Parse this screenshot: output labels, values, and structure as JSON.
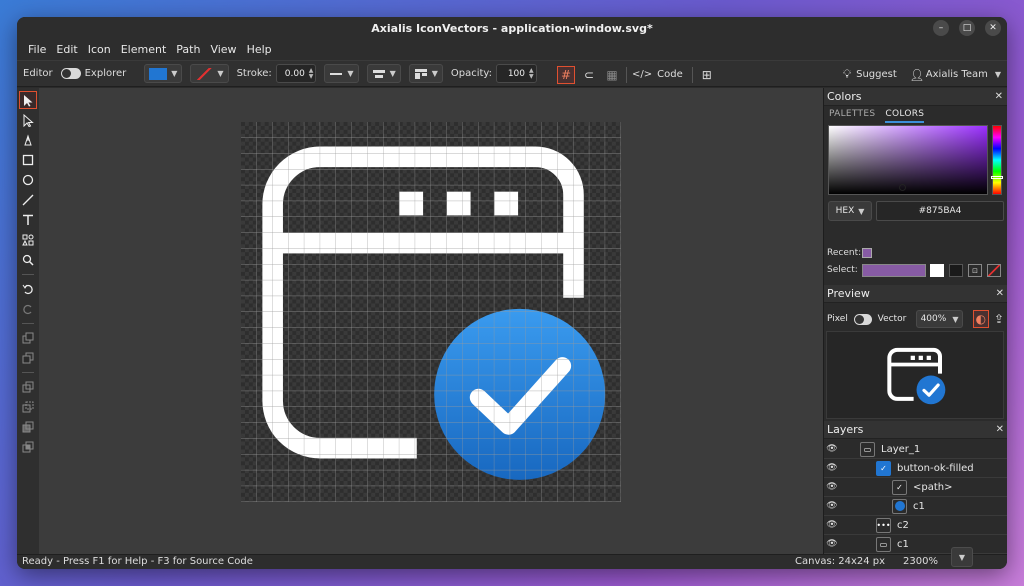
{
  "window": {
    "title": "Axialis IconVectors - application-window.svg*",
    "controls": [
      "–",
      "□",
      "✕"
    ]
  },
  "menu": [
    "File",
    "Edit",
    "Icon",
    "Element",
    "Path",
    "View",
    "Help"
  ],
  "toolbar": {
    "editor_label": "Editor",
    "explorer_label": "Explorer",
    "fill_color": "#2176d2",
    "stroke_label": "Stroke:",
    "stroke_value": "0.00",
    "opacity_label": "Opacity:",
    "opacity_value": "100",
    "code_label": "Code",
    "suggest_label": "Suggest",
    "user_label": "Axialis Team"
  },
  "tools": [
    "select",
    "direct-select",
    "pen",
    "rectangle",
    "ellipse",
    "line",
    "text",
    "shapes",
    "zoom",
    "undo",
    "redo"
  ],
  "canvas": {
    "icon_stroke_color": "#ffffff",
    "badge_color": "#2176d2"
  },
  "status": {
    "message": "Ready - Press F1 for Help - F3 for Source Code",
    "canvas_size": "Canvas: 24x24 px",
    "zoom": "2300%"
  },
  "colors_panel": {
    "title": "Colors",
    "tabs": [
      "PALETTES",
      "COLORS"
    ],
    "active_tab": "COLORS",
    "format": "HEX",
    "hex_value": "#875BA4",
    "recent_label": "Recent:",
    "select_label": "Select:",
    "current_color": "#875BA4"
  },
  "preview_panel": {
    "title": "Preview",
    "pixel_label": "Pixel",
    "vector_label": "Vector",
    "zoom": "400%"
  },
  "layers_panel": {
    "title": "Layers",
    "rows": [
      {
        "label": "Layer_1"
      },
      {
        "label": "button-ok-filled"
      },
      {
        "label": "<path>"
      },
      {
        "label": "c1"
      },
      {
        "label": "c2"
      },
      {
        "label": "c1"
      }
    ]
  }
}
